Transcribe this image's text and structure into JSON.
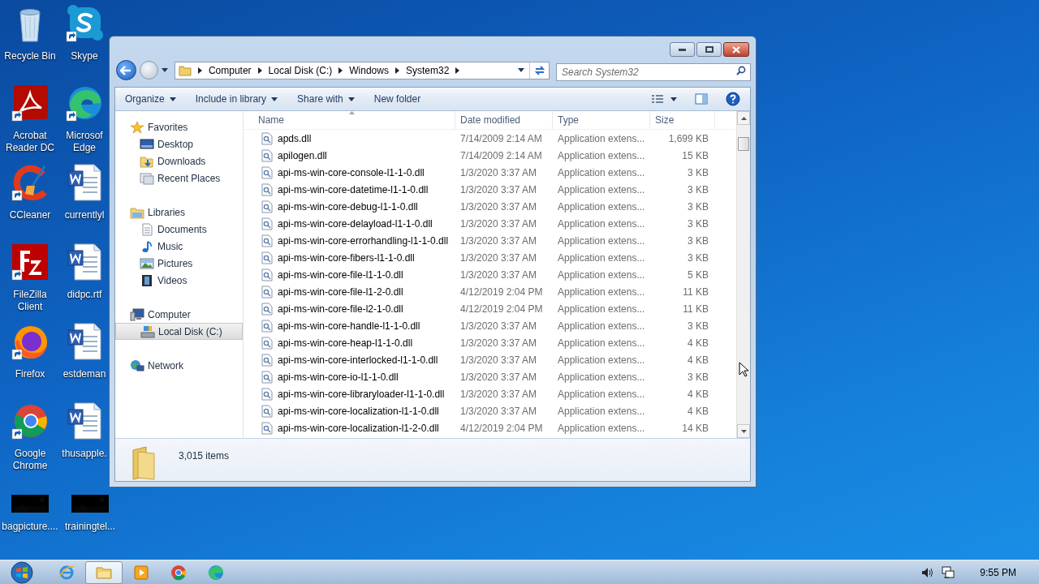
{
  "desktop": {
    "icons": [
      {
        "kind": "recycle",
        "lines": [
          "Recycle Bin"
        ],
        "shortcut": false
      },
      {
        "kind": "skype",
        "lines": [
          "Skype"
        ],
        "shortcut": true
      },
      {
        "kind": "acrobat",
        "lines": [
          "Acrobat",
          "Reader DC"
        ],
        "shortcut": true
      },
      {
        "kind": "edge",
        "lines": [
          "Microsof",
          "Edge"
        ],
        "shortcut": true
      },
      {
        "kind": "ccleaner",
        "lines": [
          "CCleaner"
        ],
        "shortcut": true
      },
      {
        "kind": "word",
        "lines": [
          "currentlyl"
        ],
        "shortcut": false
      },
      {
        "kind": "filezilla",
        "lines": [
          "FileZilla",
          "Client"
        ],
        "shortcut": true
      },
      {
        "kind": "word",
        "lines": [
          "didpc.rtf"
        ],
        "shortcut": false
      },
      {
        "kind": "firefox",
        "lines": [
          "Firefox"
        ],
        "shortcut": true
      },
      {
        "kind": "word",
        "lines": [
          "estdeman"
        ],
        "shortcut": false
      },
      {
        "kind": "chrome",
        "lines": [
          "Google",
          "Chrome"
        ],
        "shortcut": true
      },
      {
        "kind": "word",
        "lines": [
          "thusapple."
        ],
        "shortcut": false
      },
      {
        "kind": "thumbnail",
        "lines": [
          "bagpicture...."
        ],
        "shortcut": false
      },
      {
        "kind": "thumbnail",
        "lines": [
          "trainingtel..."
        ],
        "shortcut": false
      }
    ]
  },
  "window": {
    "address": {
      "crumbs": [
        "Computer",
        "Local Disk (C:)",
        "Windows",
        "System32"
      ]
    },
    "search": {
      "placeholder": "Search System32"
    },
    "toolbar": [
      {
        "label": "Organize",
        "has_menu": true
      },
      {
        "label": "Include in library",
        "has_menu": true
      },
      {
        "label": "Share with",
        "has_menu": true
      },
      {
        "label": "New folder",
        "has_menu": false
      }
    ],
    "sidebar": {
      "groups": [
        {
          "label": "Favorites",
          "kind": "star",
          "children": [
            {
              "label": "Desktop",
              "kind": "desktop",
              "selected": false
            },
            {
              "label": "Downloads",
              "kind": "downloads",
              "selected": false
            },
            {
              "label": "Recent Places",
              "kind": "recent",
              "selected": false
            }
          ]
        },
        {
          "label": "Libraries",
          "kind": "library",
          "children": [
            {
              "label": "Documents",
              "kind": "documents",
              "selected": false
            },
            {
              "label": "Music",
              "kind": "music",
              "selected": false
            },
            {
              "label": "Pictures",
              "kind": "pictures",
              "selected": false
            },
            {
              "label": "Videos",
              "kind": "videos",
              "selected": false
            }
          ]
        },
        {
          "label": "Computer",
          "kind": "computer",
          "children": [
            {
              "label": "Local Disk (C:)",
              "kind": "disk",
              "selected": true
            }
          ]
        },
        {
          "label": "Network",
          "kind": "network"
        }
      ]
    },
    "table": {
      "columns": [
        {
          "label": "Name",
          "sorted": true
        },
        {
          "label": "Date modified",
          "sorted": false
        },
        {
          "label": "Type",
          "sorted": false
        },
        {
          "label": "Size",
          "sorted": false
        }
      ],
      "rows": [
        [
          "apds.dll",
          "7/14/2009 2:14 AM",
          "Application extens...",
          "1,699 KB"
        ],
        [
          "apilogen.dll",
          "7/14/2009 2:14 AM",
          "Application extens...",
          "15 KB"
        ],
        [
          "api-ms-win-core-console-l1-1-0.dll",
          "1/3/2020 3:37 AM",
          "Application extens...",
          "3 KB"
        ],
        [
          "api-ms-win-core-datetime-l1-1-0.dll",
          "1/3/2020 3:37 AM",
          "Application extens...",
          "3 KB"
        ],
        [
          "api-ms-win-core-debug-l1-1-0.dll",
          "1/3/2020 3:37 AM",
          "Application extens...",
          "3 KB"
        ],
        [
          "api-ms-win-core-delayload-l1-1-0.dll",
          "1/3/2020 3:37 AM",
          "Application extens...",
          "3 KB"
        ],
        [
          "api-ms-win-core-errorhandling-l1-1-0.dll",
          "1/3/2020 3:37 AM",
          "Application extens...",
          "3 KB"
        ],
        [
          "api-ms-win-core-fibers-l1-1-0.dll",
          "1/3/2020 3:37 AM",
          "Application extens...",
          "3 KB"
        ],
        [
          "api-ms-win-core-file-l1-1-0.dll",
          "1/3/2020 3:37 AM",
          "Application extens...",
          "5 KB"
        ],
        [
          "api-ms-win-core-file-l1-2-0.dll",
          "4/12/2019 2:04 PM",
          "Application extens...",
          "11 KB"
        ],
        [
          "api-ms-win-core-file-l2-1-0.dll",
          "4/12/2019 2:04 PM",
          "Application extens...",
          "11 KB"
        ],
        [
          "api-ms-win-core-handle-l1-1-0.dll",
          "1/3/2020 3:37 AM",
          "Application extens...",
          "3 KB"
        ],
        [
          "api-ms-win-core-heap-l1-1-0.dll",
          "1/3/2020 3:37 AM",
          "Application extens...",
          "4 KB"
        ],
        [
          "api-ms-win-core-interlocked-l1-1-0.dll",
          "1/3/2020 3:37 AM",
          "Application extens...",
          "4 KB"
        ],
        [
          "api-ms-win-core-io-l1-1-0.dll",
          "1/3/2020 3:37 AM",
          "Application extens...",
          "3 KB"
        ],
        [
          "api-ms-win-core-libraryloader-l1-1-0.dll",
          "1/3/2020 3:37 AM",
          "Application extens...",
          "4 KB"
        ],
        [
          "api-ms-win-core-localization-l1-1-0.dll",
          "1/3/2020 3:37 AM",
          "Application extens...",
          "4 KB"
        ],
        [
          "api-ms-win-core-localization-l1-2-0.dll",
          "4/12/2019 2:04 PM",
          "Application extens...",
          "14 KB"
        ]
      ]
    },
    "status": {
      "count": "3,015 items"
    }
  },
  "taskbar": {
    "items": [
      {
        "kind": "ie",
        "selected": false
      },
      {
        "kind": "explorer",
        "selected": true
      },
      {
        "kind": "media",
        "selected": false
      },
      {
        "kind": "chrome",
        "selected": false
      },
      {
        "kind": "edge",
        "selected": false
      }
    ],
    "clock": "9:55 PM"
  }
}
